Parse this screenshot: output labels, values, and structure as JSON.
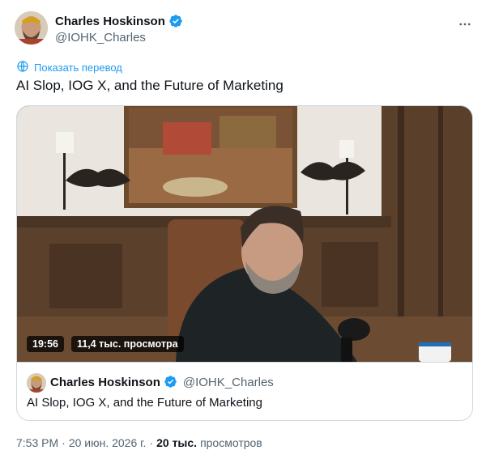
{
  "author": {
    "display_name": "Charles Hoskinson",
    "handle": "@IOHK_Charles",
    "verified": true,
    "verified_color": "#1d9bf0"
  },
  "translate_label": "Показать перевод",
  "tweet_text": "AI Slop, IOG X, and the Future of Marketing",
  "video": {
    "duration": "19:56",
    "views_label": "11,4 тыс. просмотра"
  },
  "quoted": {
    "display_name": "Charles Hoskinson",
    "handle": "@IOHK_Charles",
    "text": "AI Slop, IOG X, and the Future of Marketing"
  },
  "meta": {
    "time": "7:53 PM",
    "separator": "·",
    "date": "20 июн. 2026 г.",
    "separator2": "·",
    "views_count": "20 тыс.",
    "views_label": "просмотров"
  },
  "icons": {
    "more": "more-horizontal-icon",
    "translate": "translate-icon",
    "verified": "verified-badge-icon"
  },
  "colors": {
    "accent": "#1d9bf0",
    "text": "#0f1419",
    "secondary": "#536471",
    "border": "#cfd9de"
  }
}
